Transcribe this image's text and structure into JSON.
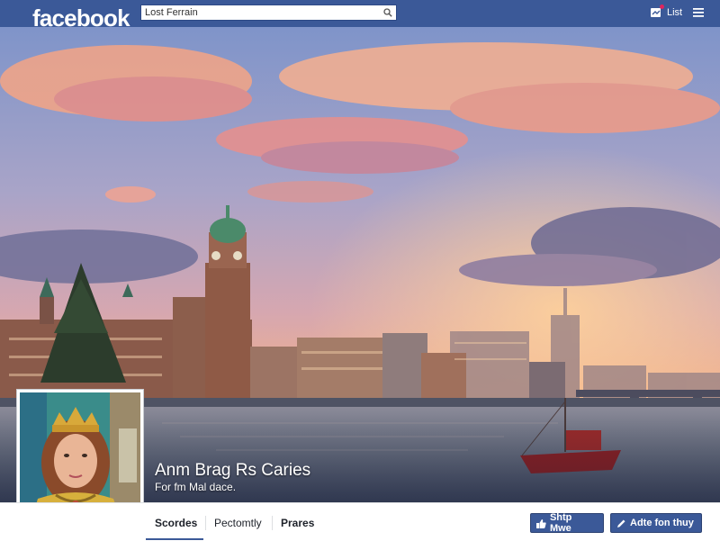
{
  "header": {
    "brand": "facebook",
    "search": {
      "value": "Lost Ferrain",
      "placeholder": ""
    },
    "list_label": "List"
  },
  "profile": {
    "name": "Anm Brag Rs Caries",
    "subtitle": "For fm Mal dace."
  },
  "nav": {
    "tabs": [
      "Scordes",
      "Pectomtly",
      "Prares"
    ],
    "buttons": {
      "primary": "Shtp Mwe",
      "secondary": "Adte fon thuy"
    }
  },
  "colors": {
    "brand_blue": "#3b5998",
    "sky_top": "#7f94c9",
    "sunset": "#f6a980",
    "water": "#5b6072"
  },
  "icons": [
    "search-icon",
    "notification-icon",
    "menu-icon",
    "thumbs-up-icon",
    "edit-icon"
  ]
}
